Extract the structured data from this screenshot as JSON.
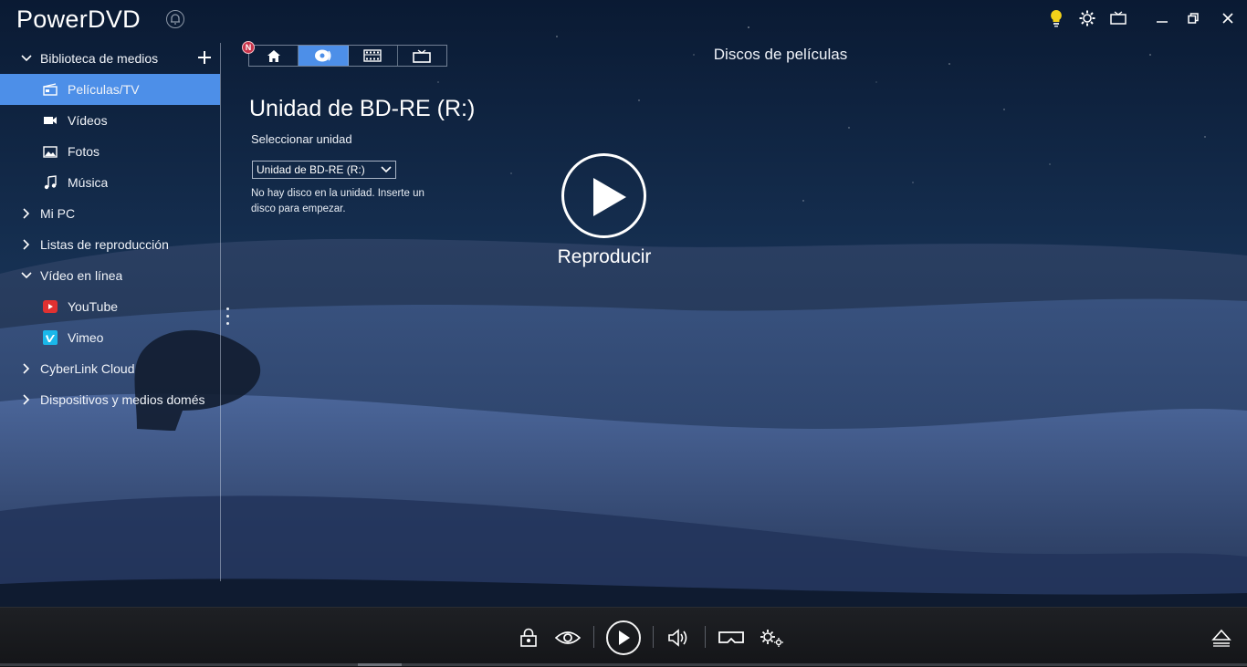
{
  "app": {
    "title": "PowerDVD"
  },
  "titlebar": {
    "icons": [
      "bulb-icon",
      "settings-icon",
      "tv-mode-icon",
      "minimize-icon",
      "restore-icon",
      "close-icon"
    ],
    "accent_bulb": "#f3d21a"
  },
  "sidebar": {
    "items": [
      {
        "label": "Biblioteca de medios",
        "level": "top",
        "expanded": true,
        "icon": "chevron-down-icon"
      },
      {
        "label": "Películas/TV",
        "level": "child",
        "selected": true,
        "icon": "movie-tv-icon"
      },
      {
        "label": "Vídeos",
        "level": "child",
        "icon": "video-camera-icon"
      },
      {
        "label": "Fotos",
        "level": "child",
        "icon": "photo-icon"
      },
      {
        "label": "Música",
        "level": "child",
        "icon": "music-note-icon"
      },
      {
        "label": "Mi PC",
        "level": "top",
        "icon": "chevron-right-icon"
      },
      {
        "label": "Listas de reproducción",
        "level": "top",
        "icon": "chevron-right-icon"
      },
      {
        "label": "Vídeo en línea",
        "level": "top",
        "expanded": true,
        "icon": "chevron-down-icon"
      },
      {
        "label": "YouTube",
        "level": "child",
        "icon": "youtube-icon"
      },
      {
        "label": "Vimeo",
        "level": "child",
        "icon": "vimeo-icon"
      },
      {
        "label": "CyberLink Cloud",
        "level": "top",
        "icon": "chevron-right-icon"
      },
      {
        "label": "Dispositivos y medios domés",
        "level": "top",
        "icon": "chevron-right-icon"
      }
    ],
    "selected_color": "#4d8fe8"
  },
  "tabs": {
    "badge": "N",
    "items": [
      {
        "name": "home",
        "icon": "home-icon"
      },
      {
        "name": "disc",
        "icon": "disc-icon",
        "active": true
      },
      {
        "name": "movies",
        "icon": "film-icon"
      },
      {
        "name": "tv",
        "icon": "tv-icon"
      }
    ]
  },
  "section_title": "Discos de películas",
  "main": {
    "drive_title": "Unidad de BD-RE (R:)",
    "select_label": "Seleccionar unidad",
    "select_value": "Unidad de BD-RE (R:)",
    "no_disc_message": "No hay disco en la unidad. Inserte un disco para empezar.",
    "play_label": "Reproducir"
  },
  "controls": {
    "icons": [
      "lock-icon",
      "eye-icon",
      "play-icon",
      "volume-icon",
      "vr-headset-icon",
      "settings-gears-icon",
      "eject-icon"
    ]
  }
}
